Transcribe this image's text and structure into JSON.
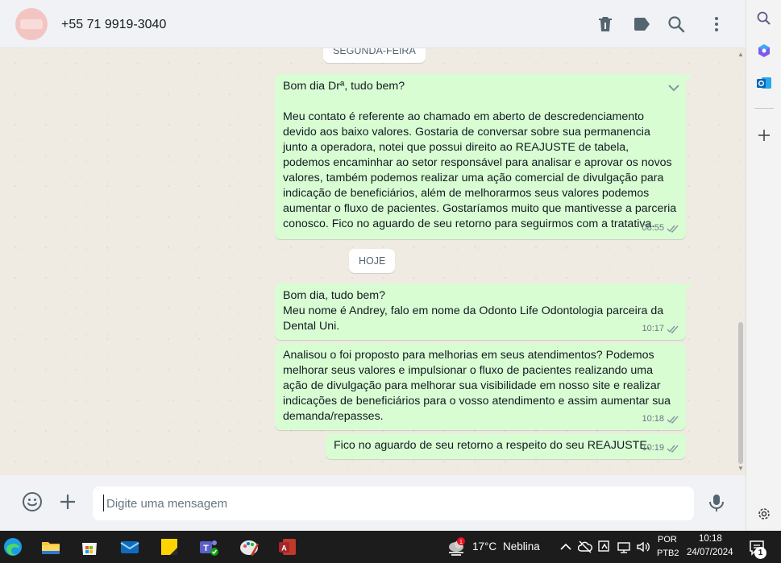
{
  "header": {
    "contact_name": "+55 71 9919-3040",
    "actions": [
      "trash-icon",
      "label-icon",
      "search-icon",
      "menu-icon"
    ]
  },
  "dates": {
    "first": "SEGUNDA-FEIRA",
    "second": "HOJE"
  },
  "messages": [
    {
      "text": "Bom dia Drª, tudo bem?\n\nMeu contato é referente ao chamado em aberto de descredenciamento devido aos baixo valores. Gostaria de conversar sobre sua permanencia junto a operadora, notei que possui direito ao REAJUSTE de tabela, podemos encaminhar ao setor responsável para analisar e aprovar os novos valores, também podemos realizar uma ação comercial de divulgação para indicação de beneficiários, além de melhorarmos seus valores podemos aumentar o fluxo de pacientes. Gostaríamos muito que mantivesse a parceria conosco. Fico no aguardo de seu retorno para seguirmos com a tratativa.",
      "time": "08:55"
    },
    {
      "text": "Bom dia, tudo bem?\nMeu nome é Andrey, falo em nome da Odonto Life Odontologia parceira da Dental Uni.",
      "time": "10:17"
    },
    {
      "text": "Analisou o foi proposto para melhorias em seus atendimentos? Podemos melhorar seus valores e impulsionar o fluxo de pacientes realizando uma ação de divulgação para melhorar sua visibilidade em nosso site e realizar indicações de beneficiários para o vosso atendimento e assim aumentar sua demanda/repasses.",
      "time": "10:18"
    },
    {
      "text": "Fico no aguardo de seu retorno a respeito do seu REAJUSTE.",
      "time": "10:19"
    }
  ],
  "composer": {
    "placeholder": "Digite uma mensagem"
  },
  "taskbar": {
    "weather_temp": "17°C",
    "weather_desc": "Neblina",
    "weather_badge": "1",
    "lang_line1": "POR",
    "lang_line2": "PTB2",
    "time": "10:18",
    "date": "24/07/2024",
    "notification_count": "1"
  },
  "colors": {
    "outgoing_bubble": "#d9fdd3",
    "chat_background": "#efeae2",
    "header_background": "#f0f2f5",
    "taskbar": "#1c1c1c"
  }
}
